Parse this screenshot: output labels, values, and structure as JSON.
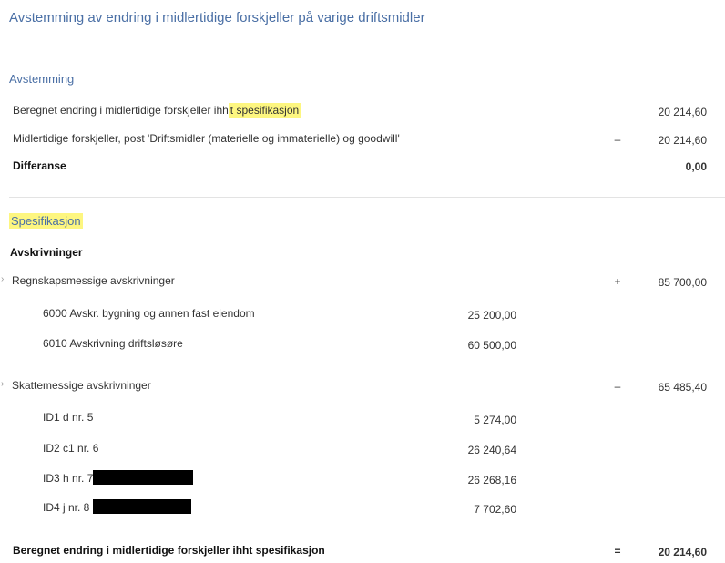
{
  "header": {
    "title": "Avstemming av endring i midlertidige forskjeller på varige driftsmidler"
  },
  "avstemming": {
    "heading": "Avstemming",
    "row1": {
      "label_pre": "Beregnet endring i midlertidige forskjeller ihh",
      "label_hl": "t spesifikasjon",
      "value": "20 214,60"
    },
    "row2": {
      "label": "Midlertidige forskjeller, post 'Driftsmidler (materielle og immaterielle) og goodwill'",
      "op": "–",
      "value": "20 214,60"
    },
    "row3": {
      "label": "Differanse",
      "value": "0,00"
    }
  },
  "spesifikasjon": {
    "heading": "Spesifikasjon",
    "subheading": "Avskrivninger",
    "regnskap": {
      "label": "Regnskapsmessige avskrivninger",
      "op": "+",
      "value": "85 700,00",
      "items": [
        {
          "label": "6000 Avskr. bygning og annen fast eiendom",
          "value": "25 200,00"
        },
        {
          "label": "6010 Avskrivning driftsløsøre",
          "value": "60 500,00"
        }
      ]
    },
    "skatt": {
      "label": "Skattemessige avskrivninger",
      "op": "–",
      "value": "65 485,40",
      "items": [
        {
          "label": "ID1 d nr. 5",
          "value": "5 274,00"
        },
        {
          "label": "ID2 c1 nr. 6",
          "value": "26 240,64"
        },
        {
          "label": "ID3 h nr. 7",
          "value": "26 268,16"
        },
        {
          "label": "ID4 j nr. 8",
          "value": "7 702,60"
        }
      ]
    },
    "total": {
      "label": "Beregnet endring i midlertidige forskjeller ihht spesifikasjon",
      "op": "=",
      "value": "20 214,60"
    }
  },
  "icons": {
    "collapse": "chevron-icon"
  },
  "colors": {
    "accent": "#4a6fa5",
    "highlight": "#fdf680"
  }
}
